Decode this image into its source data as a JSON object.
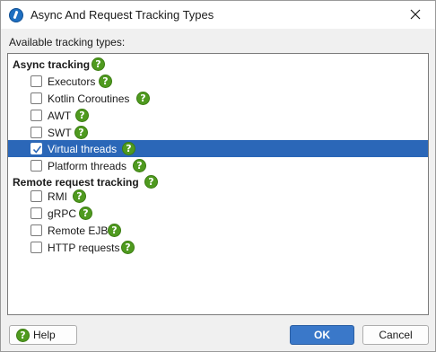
{
  "window": {
    "title": "Async And Request Tracking Types"
  },
  "section_label": "Available tracking types:",
  "groups": [
    {
      "label": "Async tracking",
      "items": [
        {
          "label": "Executors",
          "checked": false
        },
        {
          "label": "Kotlin Coroutines",
          "checked": false
        },
        {
          "label": "AWT",
          "checked": false
        },
        {
          "label": "SWT",
          "checked": false
        },
        {
          "label": "Virtual threads",
          "checked": true,
          "selected": true
        },
        {
          "label": "Platform threads",
          "checked": false
        }
      ]
    },
    {
      "label": "Remote request tracking",
      "items": [
        {
          "label": "RMI",
          "checked": false
        },
        {
          "label": "gRPC",
          "checked": false
        },
        {
          "label": "Remote EJB",
          "checked": false
        },
        {
          "label": "HTTP requests",
          "checked": false
        }
      ]
    }
  ],
  "help_glyph": "?",
  "buttons": {
    "help": "Help",
    "ok": "OK",
    "cancel": "Cancel"
  },
  "colors": {
    "selection": "#2b67b8",
    "help_icon": "#4f9a1f",
    "ok_button": "#3a78c9"
  }
}
